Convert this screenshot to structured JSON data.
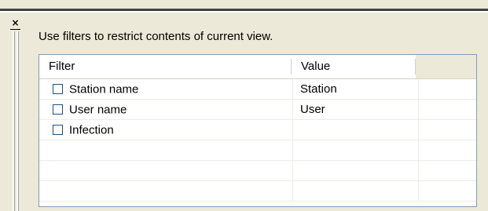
{
  "hint_text": "Use filters to restrict contents of current view.",
  "close_glyph": "×",
  "grid": {
    "headers": {
      "filter": "Filter",
      "value": "Value",
      "extra": ""
    },
    "rows": [
      {
        "label": "Station name",
        "value": "Station",
        "checked": false
      },
      {
        "label": "User name",
        "value": "User",
        "checked": false
      },
      {
        "label": "Infection",
        "value": "",
        "checked": false
      },
      {
        "label": "",
        "value": ""
      },
      {
        "label": "",
        "value": ""
      },
      {
        "label": "",
        "value": ""
      }
    ]
  },
  "colors": {
    "background": "#ece9d8",
    "grid_border": "#7f9db9",
    "checkbox_border": "#1c5180",
    "grid_line": "#ecebe6"
  }
}
